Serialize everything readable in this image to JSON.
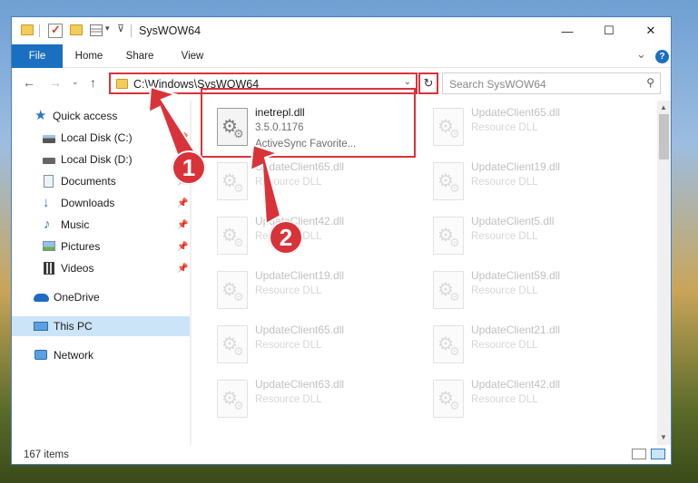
{
  "window": {
    "title": "SysWOW64",
    "minimize_glyph": "—",
    "maximize_glyph": "☐",
    "close_glyph": "✕"
  },
  "ribbon": {
    "tabs": [
      "File",
      "Home",
      "Share",
      "View"
    ],
    "expand_glyph": "⌄",
    "help_glyph": "?"
  },
  "address_bar": {
    "path": "C:\\Windows\\SysWOW64",
    "search_placeholder": "Search SysWOW64"
  },
  "sidebar": {
    "items": [
      {
        "label": "Quick access",
        "icon": "star-icon",
        "pinned": false
      },
      {
        "label": "Local Disk (C:)",
        "icon": "drive-icon",
        "pinned": true
      },
      {
        "label": "Local Disk (D:)",
        "icon": "drive-icon",
        "pinned": false
      },
      {
        "label": "Documents",
        "icon": "documents-icon",
        "pinned": true
      },
      {
        "label": "Downloads",
        "icon": "download-icon",
        "pinned": true
      },
      {
        "label": "Music",
        "icon": "music-icon",
        "pinned": true
      },
      {
        "label": "Pictures",
        "icon": "pictures-icon",
        "pinned": true
      },
      {
        "label": "Videos",
        "icon": "videos-icon",
        "pinned": true
      },
      {
        "label": "OneDrive",
        "icon": "cloud-icon",
        "pinned": false
      },
      {
        "label": "This PC",
        "icon": "pc-icon",
        "pinned": false,
        "selected": true
      },
      {
        "label": "Network",
        "icon": "network-icon",
        "pinned": false
      }
    ]
  },
  "files": [
    {
      "name": "inetrepl.dll",
      "line2": "3.5.0.1176",
      "line3": "ActiveSync Favorite...",
      "highlighted": true
    },
    {
      "name": "UpdateClient65.dll",
      "line2": "Resource DLL"
    },
    {
      "name": "UpdateClient65.dll",
      "line2": "Resource DLL"
    },
    {
      "name": "UpdateClient19.dll",
      "line2": "Resource DLL"
    },
    {
      "name": "UpdateClient42.dll",
      "line2": "Resource DLL"
    },
    {
      "name": "UpdateClient5.dll",
      "line2": "Resource DLL"
    },
    {
      "name": "UpdateClient19.dll",
      "line2": "Resource DLL"
    },
    {
      "name": "UpdateClient59.dll",
      "line2": "Resource DLL"
    },
    {
      "name": "UpdateClient65.dll",
      "line2": "Resource DLL"
    },
    {
      "name": "UpdateClient21.dll",
      "line2": "Resource DLL"
    },
    {
      "name": "UpdateClient63.dll",
      "line2": "Resource DLL"
    },
    {
      "name": "UpdateClient42.dll",
      "line2": "Resource DLL"
    }
  ],
  "status": {
    "item_count": "167 items"
  },
  "annotations": [
    {
      "number": "1"
    },
    {
      "number": "2"
    }
  ],
  "colors": {
    "accent": "#1a6fc0",
    "annotation_red": "#d9333a",
    "selection": "#cce4f7"
  }
}
